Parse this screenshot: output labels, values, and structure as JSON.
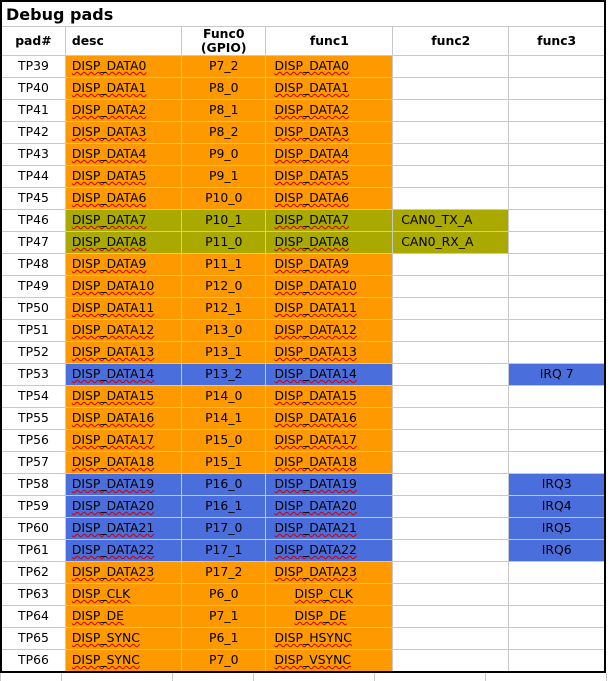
{
  "title": "Debug pads",
  "colors": {
    "orange": "#ff9900",
    "olive": "#a9a900",
    "blue": "#4a6fdc"
  },
  "headers": {
    "pad": "pad#",
    "desc": "desc",
    "func0_a": "Func0",
    "func0_b": "(GPIO)",
    "func1": "func1",
    "func2": "func2",
    "func3": "func3"
  },
  "rows": [
    {
      "pad": "TP39",
      "desc": "DISP_DATA0",
      "func0": "P7_2",
      "func1": "DISP_DATA0",
      "func2": "",
      "func3": "",
      "hl": "orange",
      "d_sp": true,
      "f1_sp": true
    },
    {
      "pad": "TP40",
      "desc": "DISP_DATA1",
      "func0": "P8_0",
      "func1": "DISP_DATA1",
      "func2": "",
      "func3": "",
      "hl": "orange",
      "d_sp": true,
      "f1_sp": true
    },
    {
      "pad": "TP41",
      "desc": "DISP_DATA2",
      "func0": "P8_1",
      "func1": "DISP_DATA2",
      "func2": "",
      "func3": "",
      "hl": "orange",
      "d_sp": true,
      "f1_sp": true
    },
    {
      "pad": "TP42",
      "desc": "DISP_DATA3",
      "func0": "P8_2",
      "func1": "DISP_DATA3",
      "func2": "",
      "func3": "",
      "hl": "orange",
      "d_sp": true,
      "f1_sp": true
    },
    {
      "pad": "TP43",
      "desc": "DISP_DATA4",
      "func0": "P9_0",
      "func1": "DISP_DATA4",
      "func2": "",
      "func3": "",
      "hl": "orange",
      "d_sp": true,
      "f1_sp": true
    },
    {
      "pad": "TP44",
      "desc": "DISP_DATA5",
      "func0": "P9_1",
      "func1": "DISP_DATA5",
      "func2": "",
      "func3": "",
      "hl": "orange",
      "d_sp": true,
      "f1_sp": true
    },
    {
      "pad": "TP45",
      "desc": "DISP_DATA6",
      "func0": "P10_0",
      "func1": "DISP_DATA6",
      "func2": "",
      "func3": "",
      "hl": "orange",
      "d_sp": true,
      "f1_sp": true
    },
    {
      "pad": "TP46",
      "desc": "DISP_DATA7",
      "func0": "P10_1",
      "func1": "DISP_DATA7",
      "func2": "CAN0_TX_A",
      "func3": "",
      "hl": "olive",
      "d_sp": true,
      "f1_sp": true
    },
    {
      "pad": "TP47",
      "desc": "DISP_DATA8",
      "func0": "P11_0",
      "func1": "DISP_DATA8",
      "func2": "CAN0_RX_A",
      "func3": "",
      "hl": "olive",
      "d_sp": true,
      "f1_sp": true
    },
    {
      "pad": "TP48",
      "desc": "DISP_DATA9",
      "func0": "P11_1",
      "func1": "DISP_DATA9",
      "func2": "",
      "func3": "",
      "hl": "orange",
      "d_sp": true,
      "f1_sp": true
    },
    {
      "pad": "TP49",
      "desc": "DISP_DATA10",
      "func0": "P12_0",
      "func1": "DISP_DATA10",
      "func2": "",
      "func3": "",
      "hl": "orange",
      "d_sp": true,
      "f1_sp": true
    },
    {
      "pad": "TP50",
      "desc": "DISP_DATA11",
      "func0": "P12_1",
      "func1": "DISP_DATA11",
      "func2": "",
      "func3": "",
      "hl": "orange",
      "d_sp": true,
      "f1_sp": true
    },
    {
      "pad": "TP51",
      "desc": "DISP_DATA12",
      "func0": "P13_0",
      "func1": "DISP_DATA12",
      "func2": "",
      "func3": "",
      "hl": "orange",
      "d_sp": true,
      "f1_sp": true
    },
    {
      "pad": "TP52",
      "desc": "DISP_DATA13",
      "func0": "P13_1",
      "func1": "DISP_DATA13",
      "func2": "",
      "func3": "",
      "hl": "orange",
      "d_sp": true,
      "f1_sp": true
    },
    {
      "pad": "TP53",
      "desc": "DISP_DATA14",
      "func0": "P13_2",
      "func1": "DISP_DATA14",
      "func2": "",
      "func3": "IRQ 7",
      "hl": "blue",
      "d_sp": true,
      "f1_sp": true
    },
    {
      "pad": "TP54",
      "desc": "DISP_DATA15",
      "func0": "P14_0",
      "func1": "DISP_DATA15",
      "func2": "",
      "func3": "",
      "hl": "orange",
      "d_sp": true,
      "f1_sp": true
    },
    {
      "pad": "TP55",
      "desc": "DISP_DATA16",
      "func0": "P14_1",
      "func1": "DISP_DATA16",
      "func2": "",
      "func3": "",
      "hl": "orange",
      "d_sp": true,
      "f1_sp": true
    },
    {
      "pad": "TP56",
      "desc": "DISP_DATA17",
      "func0": "P15_0",
      "func1": "DISP_DATA17",
      "func2": "",
      "func3": "",
      "hl": "orange",
      "d_sp": true,
      "f1_sp": true
    },
    {
      "pad": "TP57",
      "desc": "DISP_DATA18",
      "func0": "P15_1",
      "func1": "DISP_DATA18",
      "func2": "",
      "func3": "",
      "hl": "orange",
      "d_sp": true,
      "f1_sp": true
    },
    {
      "pad": "TP58",
      "desc": "DISP_DATA19",
      "func0": "P16_0",
      "func1": "DISP_DATA19",
      "func2": "",
      "func3": "IRQ3",
      "hl": "blue",
      "d_sp": true,
      "f1_sp": true
    },
    {
      "pad": "TP59",
      "desc": "DISP_DATA20",
      "func0": "P16_1",
      "func1": "DISP_DATA20",
      "func2": "",
      "func3": "IRQ4",
      "hl": "blue",
      "d_sp": true,
      "f1_sp": true
    },
    {
      "pad": "TP60",
      "desc": "DISP_DATA21",
      "func0": "P17_0",
      "func1": "DISP_DATA21",
      "func2": "",
      "func3": "IRQ5",
      "hl": "blue",
      "d_sp": true,
      "f1_sp": true
    },
    {
      "pad": "TP61",
      "desc": "DISP_DATA22",
      "func0": "P17_1",
      "func1": "DISP_DATA22",
      "func2": "",
      "func3": "IRQ6",
      "hl": "blue",
      "d_sp": true,
      "f1_sp": true
    },
    {
      "pad": "TP62",
      "desc": "DISP_DATA23",
      "func0": "P17_2",
      "func1": "DISP_DATA23",
      "func2": "",
      "func3": "",
      "hl": "orange",
      "d_sp": true,
      "f1_sp": true
    },
    {
      "pad": "TP63",
      "desc": "DISP_CLK",
      "func0": "P6_0",
      "func1": "DISP_CLK",
      "func2": "",
      "func3": "",
      "hl": "orange",
      "d_sp": true,
      "f1_sp": true,
      "f1_indent": true
    },
    {
      "pad": "TP64",
      "desc": "DISP_DE",
      "func0": "P7_1",
      "func1": "DISP_DE",
      "func2": "",
      "func3": "",
      "hl": "orange",
      "d_sp": true,
      "f1_sp": true,
      "f1_indent": true
    },
    {
      "pad": "TP65",
      "desc": "DISP_SYNC",
      "func0": "P6_1",
      "func1": "DISP_HSYNC",
      "func2": "",
      "func3": "",
      "hl": "orange",
      "d_sp": true,
      "f1_sp": true
    },
    {
      "pad": "TP66",
      "desc": "DISP_SYNC",
      "func0": "P7_0",
      "func1": "DISP_VSYNC",
      "func2": "",
      "func3": "",
      "hl": "orange",
      "d_sp": true,
      "f1_sp": true
    }
  ]
}
